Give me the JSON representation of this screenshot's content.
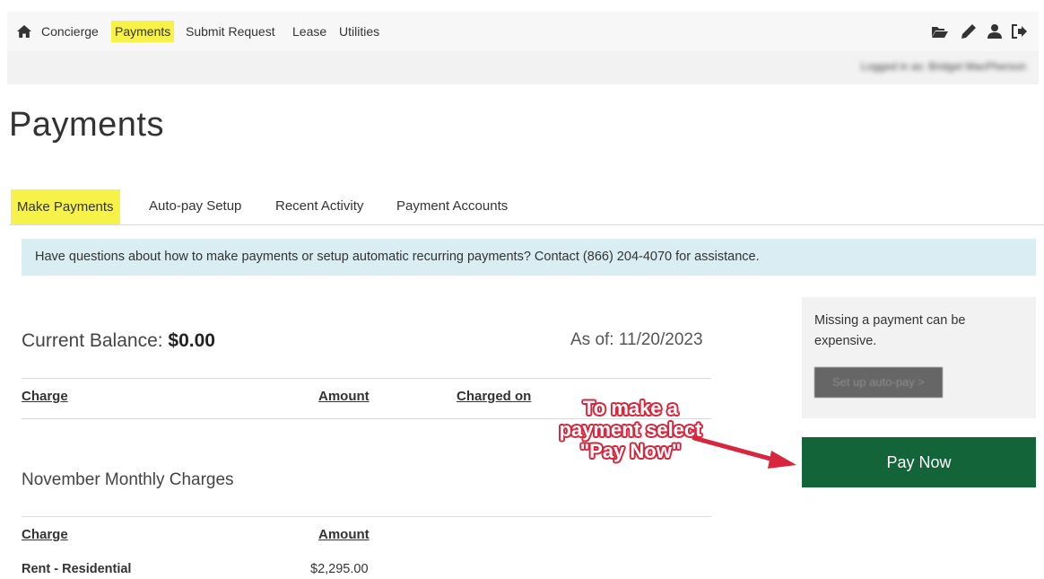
{
  "nav": {
    "home_icon": "home-icon",
    "items": [
      {
        "label": "Concierge",
        "active": false
      },
      {
        "label": "Payments",
        "active": true
      },
      {
        "label": "Submit Request",
        "active": false
      },
      {
        "label": "Lease",
        "active": false
      },
      {
        "label": "Utilities",
        "active": false
      }
    ],
    "tools": [
      "folder-open-icon",
      "pencil-icon",
      "user-icon",
      "sign-out-icon"
    ],
    "highlight_color": "#f6f248"
  },
  "login_bar": {
    "text": "Logged in as: Bridget MacPherson"
  },
  "page_title": "Payments",
  "tabs": [
    {
      "label": "Make Payments",
      "active": true
    },
    {
      "label": "Auto-pay Setup",
      "active": false
    },
    {
      "label": "Recent Activity",
      "active": false
    },
    {
      "label": "Payment Accounts",
      "active": false
    }
  ],
  "info_banner": "Have questions about how to make payments or setup automatic recurring payments? Contact (866) 204-4070 for assistance.",
  "balance": {
    "label": "Current Balance: ",
    "amount": "$0.00",
    "as_of": "As of: 11/20/2023"
  },
  "charges_table": {
    "headers": [
      "Charge",
      "Amount",
      "Charged on"
    ]
  },
  "monthly": {
    "title": "November Monthly Charges",
    "headers": [
      "Charge",
      "Amount"
    ],
    "rows": [
      {
        "charge": "Rent - Residential",
        "amount": "$2,295.00"
      }
    ]
  },
  "promo": {
    "text": "Missing a payment can be expensive.",
    "button": "Set up auto-pay >"
  },
  "pay_now": {
    "label": "Pay Now",
    "color": "#14643a"
  },
  "annotation": {
    "text": "To make a payment select \"Pay Now\"",
    "color": "#d7263d"
  }
}
